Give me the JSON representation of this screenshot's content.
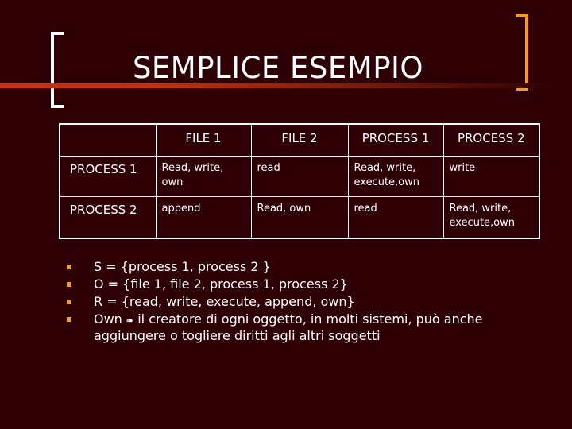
{
  "slide": {
    "title": "SEMPLICE ESEMPIO",
    "colors": {
      "background": "#2e0005",
      "title_rule": "#c8320a",
      "left_bracket": "#ffffff",
      "right_bracket": "#ff9a10",
      "bullet": "#f0a03a"
    }
  },
  "table": {
    "headers": [
      "",
      "FILE 1",
      "FILE 2",
      "PROCESS 1",
      "PROCESS 2"
    ],
    "rows": [
      {
        "label": "PROCESS 1",
        "cells": [
          "Read, write, own",
          "read",
          "Read, write, execute,own",
          "write"
        ]
      },
      {
        "label": "PROCESS 2",
        "cells": [
          "append",
          "Read, own",
          "read",
          "Read, write, execute,own"
        ]
      }
    ]
  },
  "bullets": [
    {
      "text": "S = {process 1, process 2 }"
    },
    {
      "text": "O = {file 1, file 2, process 1, process 2}"
    },
    {
      "text": "R = {read, write, execute, append, own}"
    },
    {
      "prefix": "Own",
      "arrow_icon": "➠",
      "text": "il creatore di ogni oggetto, in molti sistemi, può anche aggiungere o togliere diritti agli altri soggetti"
    }
  ]
}
